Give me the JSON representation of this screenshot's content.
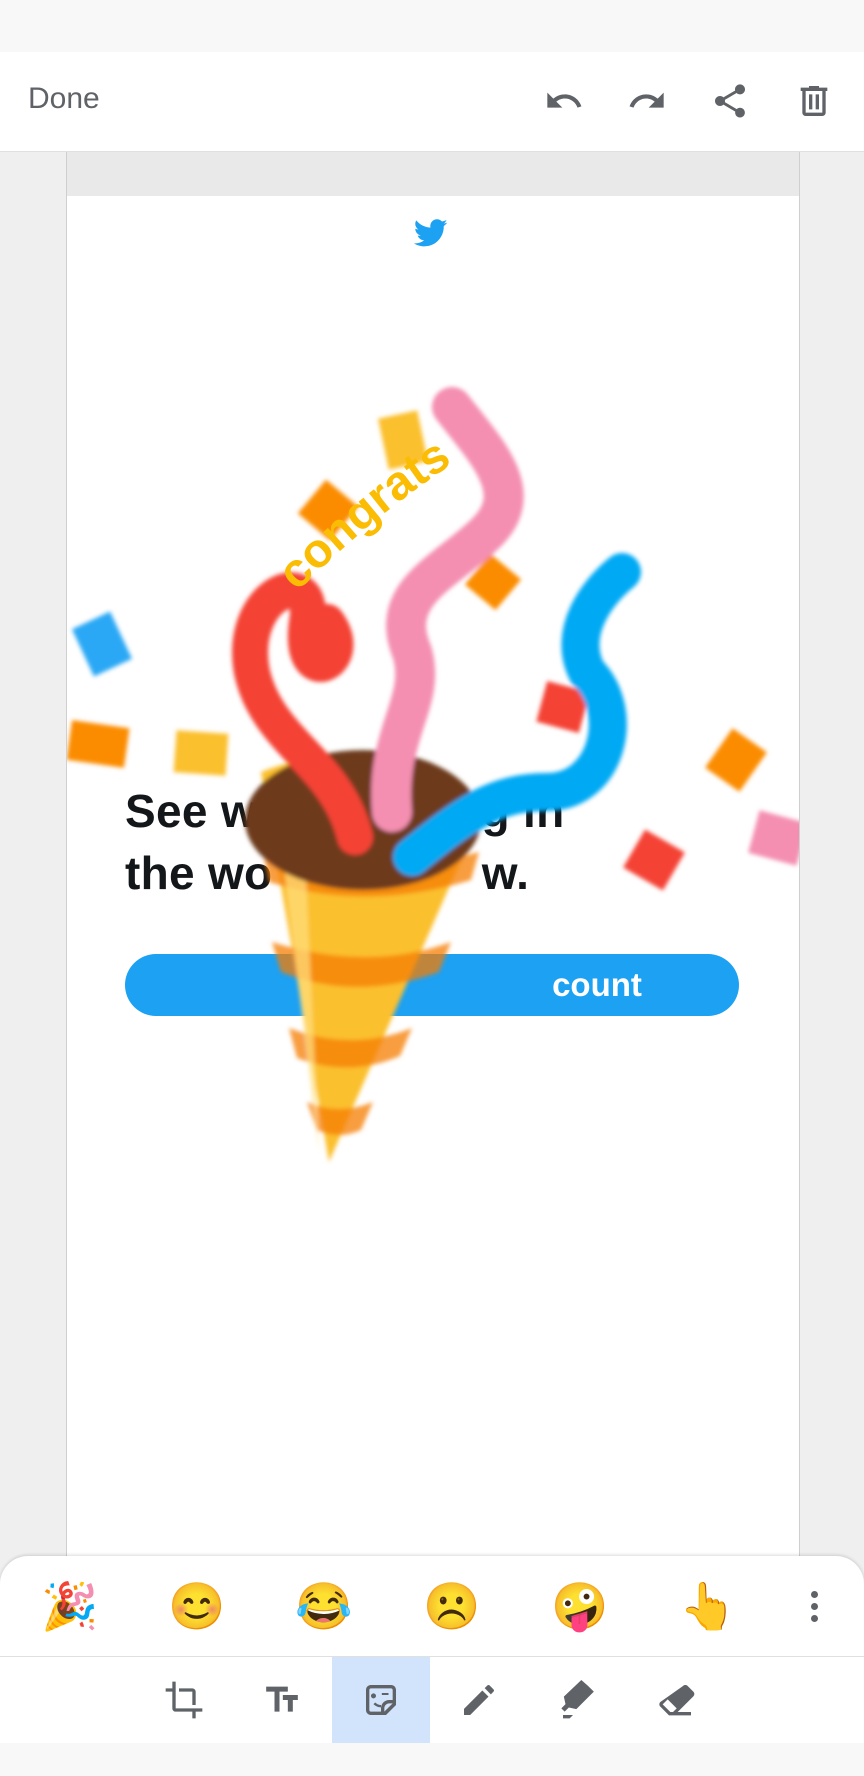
{
  "toolbar": {
    "done_label": "Done",
    "icons": [
      "undo-icon",
      "redo-icon",
      "share-icon",
      "delete-icon"
    ]
  },
  "screenshot": {
    "headline_line1": "See w              ing in",
    "headline_line2": "the wo                w.",
    "cta_label": "count",
    "sticker_text": "congrats"
  },
  "sticker_tray": {
    "emojis": [
      "🎉",
      "😊",
      "😂",
      "☹️",
      "🤪",
      "👆"
    ],
    "more_icon": "more-vert-icon"
  },
  "tools": {
    "items": [
      "crop-icon",
      "text-icon",
      "sticker-icon",
      "pen-icon",
      "highlighter-icon",
      "eraser-icon"
    ],
    "active": "sticker-icon"
  },
  "colors": {
    "twitter_blue": "#1da1f2",
    "active_tool_bg": "#d2e3fc",
    "icon_gray": "#5f6368"
  }
}
